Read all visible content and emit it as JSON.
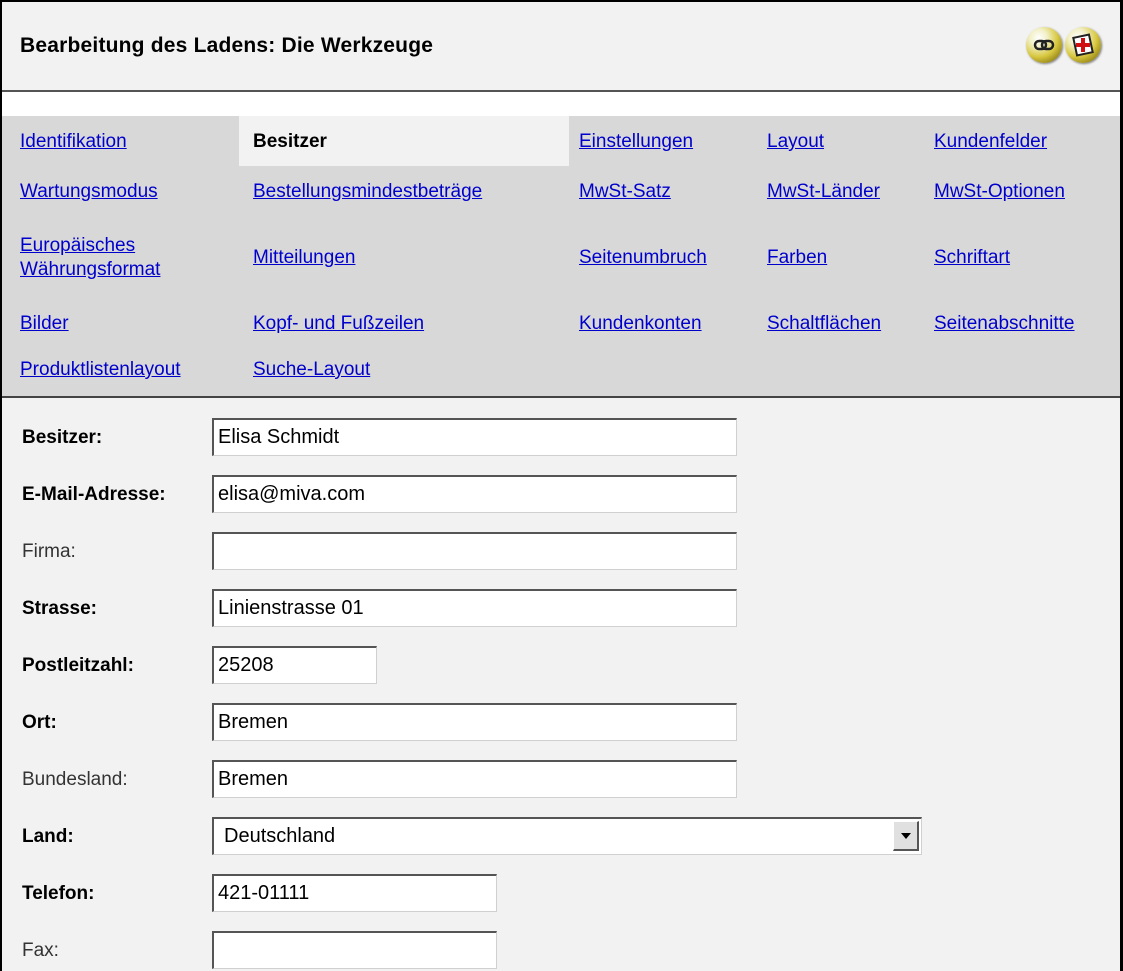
{
  "header": {
    "title": "Bearbeitung des Ladens: Die Werkzeuge",
    "icons": [
      "link-icon",
      "help-icon"
    ]
  },
  "tabs": {
    "active": "Besitzer",
    "items": [
      [
        "Identifikation",
        "Besitzer",
        "Einstellungen",
        "Layout",
        "Kundenfelder"
      ],
      [
        "Wartungsmodus",
        "Bestellungsmindestbeträge",
        "MwSt-Satz",
        "MwSt-Länder",
        "MwSt-Optionen"
      ],
      [
        "Europäisches Währungsformat",
        "Mitteilungen",
        "Seitenumbruch",
        "Farben",
        "Schriftart"
      ],
      [
        "Bilder",
        "Kopf- und Fußzeilen",
        "Kundenkonten",
        "Schaltflächen",
        "Seitenabschnitte"
      ],
      [
        "Produktlistenlayout",
        "Suche-Layout"
      ]
    ]
  },
  "form": {
    "owner": {
      "label": "Besitzer:",
      "value": "Elisa Schmidt"
    },
    "email": {
      "label": "E-Mail-Adresse:",
      "value": "elisa@miva.com"
    },
    "company": {
      "label": "Firma:",
      "value": ""
    },
    "street": {
      "label": "Strasse:",
      "value": "Linienstrasse 01"
    },
    "zip": {
      "label": "Postleitzahl:",
      "value": "25208"
    },
    "city": {
      "label": "Ort:",
      "value": "Bremen"
    },
    "state": {
      "label": "Bundesland:",
      "value": "Bremen"
    },
    "country": {
      "label": "Land:",
      "value": "Deutschland"
    },
    "phone": {
      "label": "Telefon:",
      "value": "421-01111"
    },
    "fax": {
      "label": "Fax:",
      "value": ""
    }
  }
}
